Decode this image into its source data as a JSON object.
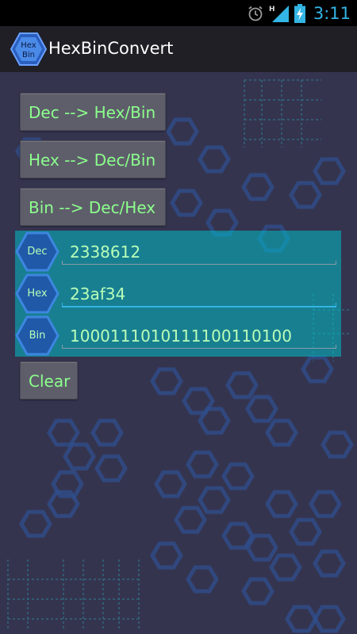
{
  "status_bar": {
    "time": "3:11",
    "icons": [
      "alarm-icon",
      "signal-h-icon",
      "battery-charging-icon"
    ],
    "accent": "#33b5e5"
  },
  "app_bar": {
    "icon_text": [
      "Hex",
      "Bin"
    ],
    "title": "HexBinConvert"
  },
  "buttons": {
    "dec_to_hexbin": "Dec --> Hex/Bin",
    "hex_to_decbin": "Hex --> Dec/Bin",
    "bin_to_dechex": "Bin --> Dec/Hex",
    "clear": "Clear"
  },
  "converter": {
    "rows": [
      {
        "label": "Dec",
        "value": "2338612"
      },
      {
        "label": "Hex",
        "value": "23af34"
      },
      {
        "label": "Bin",
        "value": "1000111010111100110100"
      }
    ]
  },
  "colors": {
    "text_green": "#8cff8c",
    "panel": "#00bec8",
    "background": "#35344f"
  }
}
